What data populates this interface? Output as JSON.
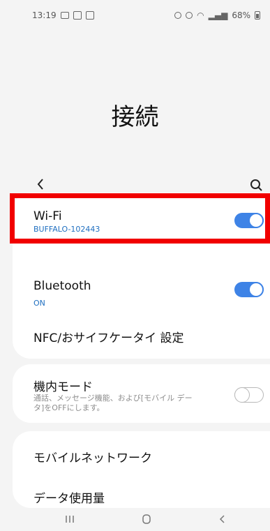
{
  "status_bar": {
    "time": "13:19",
    "battery": "68%"
  },
  "page": {
    "title": "接続"
  },
  "toolbar": {
    "back_icon": "chevron-left-icon",
    "search_icon": "search-icon"
  },
  "settings": {
    "wifi": {
      "title": "Wi-Fi",
      "subtitle": "BUFFALO-102443",
      "enabled": true
    },
    "bluetooth": {
      "title": "Bluetooth",
      "subtitle": "ON",
      "enabled": true
    },
    "nfc": {
      "title": "NFC/おサイフケータイ 設定"
    },
    "airplane": {
      "title": "機内モード",
      "description": "通話、メッセージ機能、および[モバイル データ]をOFFにします。",
      "enabled": false
    },
    "mobile_network": {
      "title": "モバイルネットワーク"
    },
    "data_usage": {
      "title": "データ使用量"
    }
  },
  "nav_bar": {
    "recents_icon": "recents-icon",
    "home_icon": "home-icon",
    "back_icon": "back-icon"
  },
  "colors": {
    "accent": "#3e83e6",
    "link": "#1f6fc0",
    "highlight": "#f10000"
  }
}
